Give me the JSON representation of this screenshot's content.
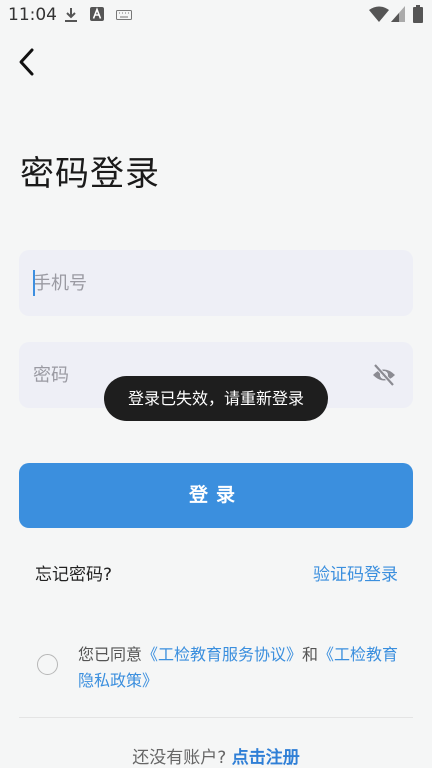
{
  "status_bar": {
    "time": "11:04",
    "icons": [
      "download-icon",
      "a-badge-icon",
      "keyboard-icon",
      "wifi-icon",
      "signal-icon",
      "battery-icon"
    ]
  },
  "header": {
    "back_icon": "chevron-left-icon"
  },
  "page": {
    "title": "密码登录"
  },
  "form": {
    "phone_placeholder": "手机号",
    "password_placeholder": "密码",
    "password_visibility_icon": "eye-off-icon"
  },
  "toast": {
    "text": "登录已失效，请重新登录"
  },
  "buttons": {
    "login": "登录",
    "forgot_password": "忘记密码?",
    "sms_login": "验证码登录"
  },
  "agreement": {
    "prefix": "您已同意",
    "service_link": "《工检教育服务协议》",
    "and": "和",
    "privacy_link": "《工检教育隐私政策》"
  },
  "signup": {
    "prompt": "还没有账户?",
    "link": "点击注册"
  },
  "colors": {
    "accent": "#3b8fde",
    "background": "#f5f6f6",
    "input_bg": "#eeeff6",
    "toast_bg": "#1e1e1e"
  }
}
